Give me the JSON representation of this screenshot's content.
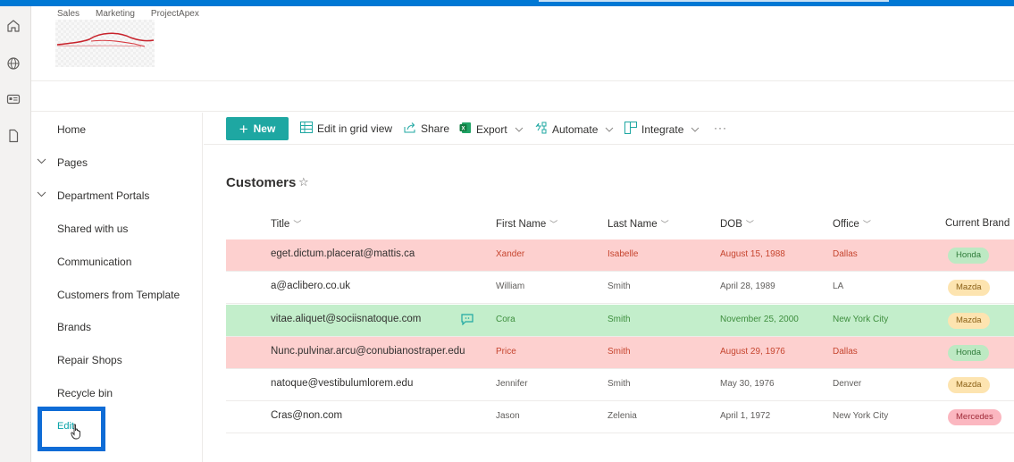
{
  "hub_nav": [
    "Sales",
    "Marketing",
    "ProjectApex"
  ],
  "rail_icons": [
    "home-icon",
    "globe-icon",
    "news-icon",
    "file-icon"
  ],
  "left_nav": {
    "items": [
      {
        "label": "Home",
        "expandable": false
      },
      {
        "label": "Pages",
        "expandable": true
      },
      {
        "label": "Department Portals",
        "expandable": true
      },
      {
        "label": "Shared with us",
        "expandable": false
      },
      {
        "label": "Communication",
        "expandable": false
      },
      {
        "label": "Customers from Template",
        "expandable": false
      },
      {
        "label": "Brands",
        "expandable": false
      },
      {
        "label": "Repair Shops",
        "expandable": false
      },
      {
        "label": "Recycle bin",
        "expandable": false
      }
    ],
    "edit_label": "Edit"
  },
  "command_bar": {
    "new_label": "New",
    "edit_grid_label": "Edit in grid view",
    "share_label": "Share",
    "export_label": "Export",
    "automate_label": "Automate",
    "integrate_label": "Integrate",
    "more_label": "···"
  },
  "list": {
    "title": "Customers",
    "columns": [
      "Title",
      "First Name",
      "Last Name",
      "DOB",
      "Office",
      "Current Brand"
    ],
    "rows": [
      {
        "title": "eget.dictum.placerat@mattis.ca",
        "first": "Xander",
        "last": "Isabelle",
        "dob": "August 15, 1988",
        "office": "Dallas",
        "brand": "Honda",
        "highlight": "red",
        "comment": false
      },
      {
        "title": "a@aclibero.co.uk",
        "first": "William",
        "last": "Smith",
        "dob": "April 28, 1989",
        "office": "LA",
        "brand": "Mazda",
        "highlight": "plain",
        "comment": false
      },
      {
        "title": "vitae.aliquet@sociisnatoque.com",
        "first": "Cora",
        "last": "Smith",
        "dob": "November 25, 2000",
        "office": "New York City",
        "brand": "Mazda",
        "highlight": "green",
        "comment": true
      },
      {
        "title": "Nunc.pulvinar.arcu@conubianostraper.edu",
        "first": "Price",
        "last": "Smith",
        "dob": "August 29, 1976",
        "office": "Dallas",
        "brand": "Honda",
        "highlight": "red",
        "comment": false
      },
      {
        "title": "natoque@vestibulumlorem.edu",
        "first": "Jennifer",
        "last": "Smith",
        "dob": "May 30, 1976",
        "office": "Denver",
        "brand": "Mazda",
        "highlight": "plain",
        "comment": false
      },
      {
        "title": "Cras@non.com",
        "first": "Jason",
        "last": "Zelenia",
        "dob": "April 1, 1972",
        "office": "New York City",
        "brand": "Mercedes",
        "highlight": "plain",
        "comment": false
      }
    ]
  },
  "colors": {
    "suite_bar": "#0078d4",
    "accent": "#1ea7a2",
    "row_red": "#fdd0cf",
    "row_green": "#c3eecb",
    "focus_box": "#0f6cd6"
  }
}
